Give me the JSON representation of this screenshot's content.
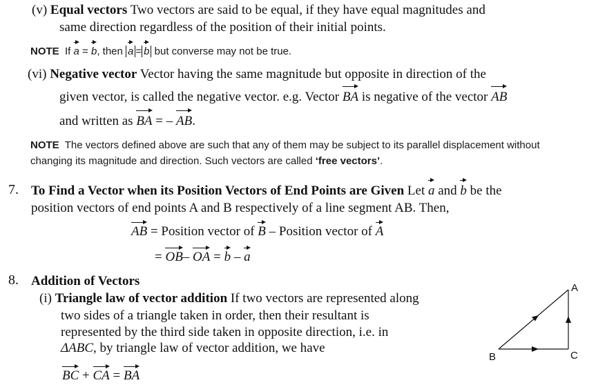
{
  "v": {
    "num": "(v)",
    "title": "Equal vectors",
    "line1": "Two vectors are said to be equal, if they have equal magnitudes and",
    "line2": "same direction regardless of the position of their initial points."
  },
  "note1": {
    "label": "NOTE",
    "pre": "If",
    "a": "a",
    "eq": "=",
    "b": "b",
    "mid": ", then",
    "abs_eq": "=",
    "post": "but converse may not be true."
  },
  "vi": {
    "num": "(vi)",
    "title": "Negative vector",
    "line1": "Vector having the same magnitude but opposite in direction of the",
    "line2a": "given vector, is called the negative vector. e.g. Vector",
    "BA": "BA",
    "line2b": "is negative of the vector",
    "AB": "AB",
    "line3a": "and written as",
    "line3b": "= –",
    "end": "."
  },
  "note2": {
    "label": "NOTE",
    "line1": "The vectors defined above are such that any of them may be subject to its parallel displacement without",
    "line2": "changing its magnitude and direction. Such vectors are called",
    "free": "‘free vectors’",
    "end": "."
  },
  "s7": {
    "num": "7.",
    "title": "To Find a Vector when its Position Vectors of End Points are Given",
    "let": "Let",
    "a": "a",
    "and": "and",
    "b": "b",
    "be": "be the",
    "line2": "position vectors of end points A and B respectively of a line segment AB. Then,",
    "eq1_lhs": "AB",
    "eq1_rhs": "= Position vector of",
    "eq1_B": "B",
    "eq1_mid": "– Position vector  of",
    "eq1_A": "A",
    "eq2_OB": "OB",
    "eq2_OA": "OA",
    "eq2_b": "b",
    "eq2_a": "a",
    "eq2_s1": "=",
    "eq2_s2": "–",
    "eq2_s3": "=",
    "eq2_s4": "–"
  },
  "s8": {
    "num": "8.",
    "title": "Addition of Vectors",
    "i_num": "(i)",
    "i_title": "Triangle law of vector addition",
    "i_line1": "If two vectors are represented along",
    "i_line2": "two sides of a triangle taken in order, then their resultant is",
    "i_line3": "represented by the third side taken in opposite direction, i.e. in",
    "i_line4a": "ΔABC",
    "i_line4b": ", by triangle law of vector addition, we have",
    "eq_BC": "BC",
    "eq_CA": "CA",
    "eq_BA": "BA",
    "eq_plus": "+",
    "eq_eq": "="
  },
  "figure": {
    "A": "A",
    "B": "B",
    "C": "C"
  }
}
